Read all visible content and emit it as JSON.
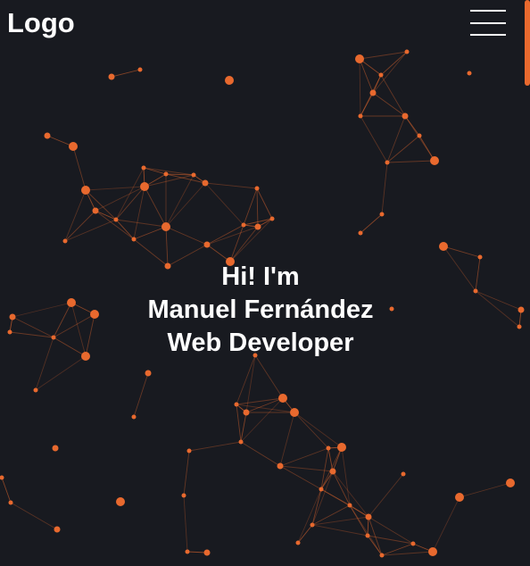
{
  "header": {
    "logo_text": "Logo",
    "menu_icon": "hamburger-icon"
  },
  "hero": {
    "greeting": "Hi! I'm",
    "name": "Manuel Fernández",
    "role": "Web Developer"
  },
  "colors": {
    "background": "#181a20",
    "accent": "#e8692e",
    "text": "#ffffff"
  }
}
